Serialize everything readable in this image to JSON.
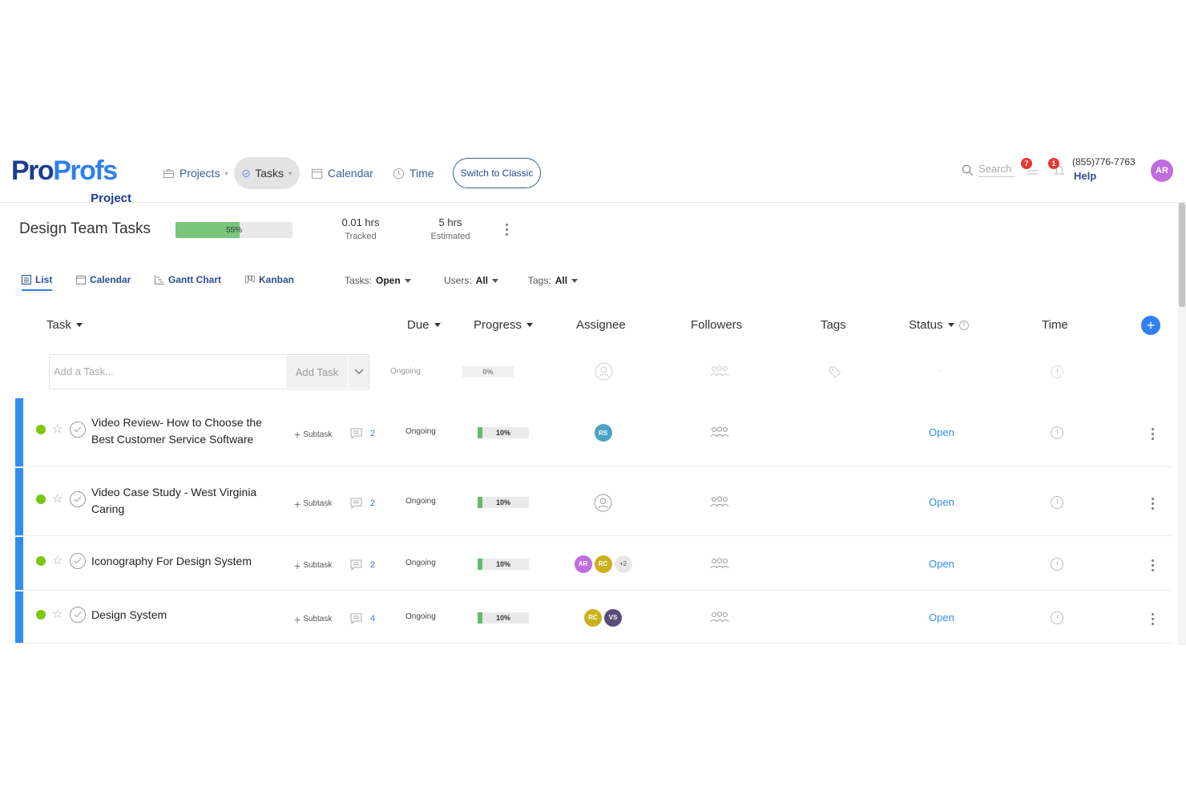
{
  "logo": {
    "part1": "Pro",
    "part2": "Profs",
    "sub": "Project"
  },
  "nav": {
    "items": [
      {
        "label": "Projects",
        "icon": "briefcase-icon"
      },
      {
        "label": "Tasks",
        "icon": "check-circle-icon",
        "active": true
      },
      {
        "label": "Calendar",
        "icon": "calendar-icon"
      },
      {
        "label": "Time",
        "icon": "clock-icon"
      }
    ],
    "switch_label": "Switch to Classic",
    "search_placeholder": "Search",
    "tasks_badge": "7",
    "notif_badge": "1",
    "phone": "(855)776-7763",
    "help": "Help",
    "user_initials": "AR"
  },
  "project": {
    "title": "Design Team Tasks",
    "progress_pct": 55,
    "progress_label": "55%",
    "tracked_value": "0.01 hrs",
    "tracked_label": "Tracked",
    "estimated_value": "5 hrs",
    "estimated_label": "Estimated"
  },
  "views": [
    "List",
    "Calendar",
    "Gantt Chart",
    "Kanban"
  ],
  "filters": {
    "tasks_label": "Tasks:",
    "tasks_value": "Open",
    "users_label": "Users:",
    "users_value": "All",
    "tags_label": "Tags:",
    "tags_value": "All"
  },
  "columns": {
    "task": "Task",
    "due": "Due",
    "progress": "Progress",
    "assignee": "Assignee",
    "followers": "Followers",
    "tags": "Tags",
    "status": "Status",
    "time": "Time"
  },
  "add_row": {
    "placeholder": "Add a Task...",
    "button": "Add Task",
    "due": "Ongoing",
    "progress_label": "0%",
    "status": "-"
  },
  "tasks": [
    {
      "name": "Video Review- How to Choose the Best Customer Service Software",
      "subtask": "Subtask",
      "comments": "2",
      "due": "Ongoing",
      "progress_pct": 10,
      "progress_label": "10%",
      "assignees": [
        {
          "initials": "RS",
          "color": "#4aa3c4"
        }
      ],
      "status": "Open"
    },
    {
      "name": "Video Case Study - West Virginia Caring",
      "subtask": "Subtask",
      "comments": "2",
      "due": "Ongoing",
      "progress_pct": 10,
      "progress_label": "10%",
      "assignees": [],
      "status": "Open"
    },
    {
      "name": "Iconography For Design System",
      "subtask": "Subtask",
      "comments": "2",
      "due": "Ongoing",
      "progress_pct": 10,
      "progress_label": "10%",
      "assignees": [
        {
          "initials": "AR",
          "color": "#c06be0"
        },
        {
          "initials": "RC",
          "color": "#c9b21e"
        }
      ],
      "extra_assignees": "+2",
      "status": "Open"
    },
    {
      "name": "Design System",
      "subtask": "Subtask",
      "comments": "4",
      "due": "Ongoing",
      "progress_pct": 10,
      "progress_label": "10%",
      "assignees": [
        {
          "initials": "RC",
          "color": "#c9b21e"
        },
        {
          "initials": "VS",
          "color": "#5a4a7a"
        }
      ],
      "status": "Open"
    }
  ],
  "colors": {
    "accent": "#2f7ff0",
    "brand_dark": "#1d3c8f",
    "progress_green": "#66bb6a",
    "status_open": "#2f8ef0",
    "row_strip": "#2f8ef0"
  }
}
